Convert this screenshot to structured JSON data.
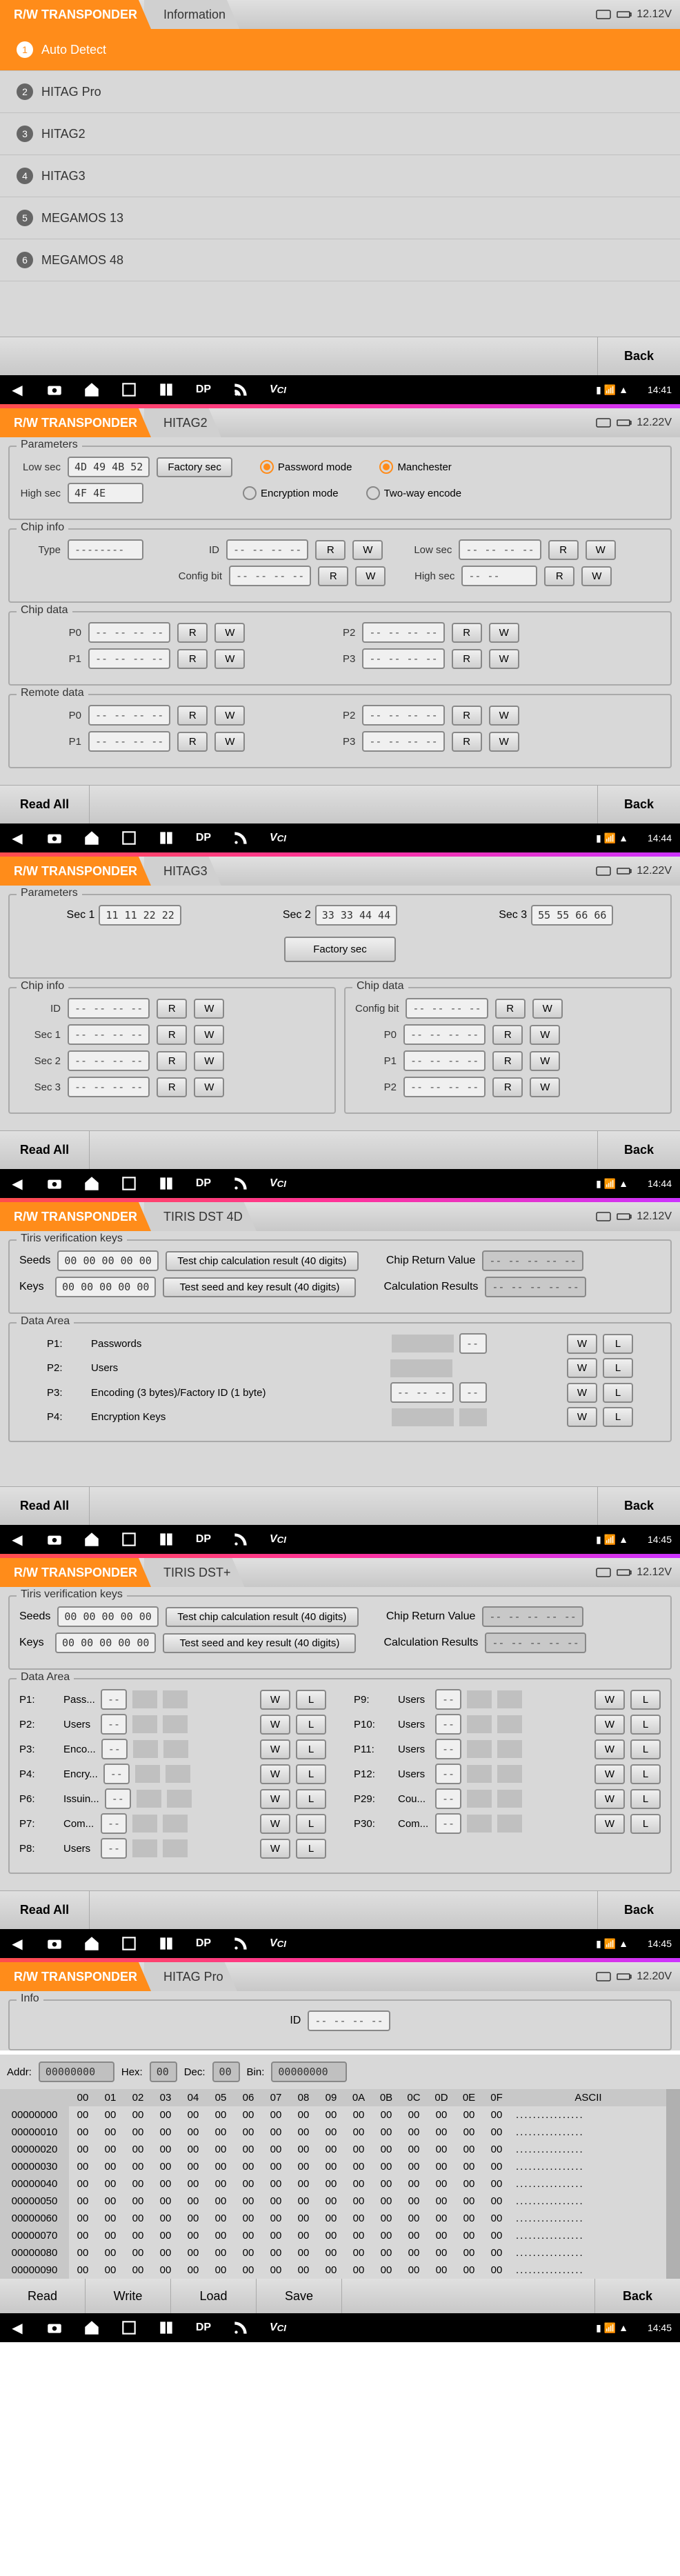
{
  "screen1": {
    "tab1": "R/W TRANSPONDER",
    "tab2": "Information",
    "voltage": "12.12V",
    "items": [
      "Auto Detect",
      "HITAG Pro",
      "HITAG2",
      "HITAG3",
      "MEGAMOS 13",
      "MEGAMOS 48"
    ],
    "back": "Back",
    "time": "14:41"
  },
  "screen2": {
    "tab1": "R/W TRANSPONDER",
    "tab2": "HITAG2",
    "voltage": "12.22V",
    "params_title": "Parameters",
    "lowsec_label": "Low sec",
    "lowsec_val": "4D 49 4B 52",
    "highsec_label": "High sec",
    "highsec_val": "4F 4E",
    "factory_sec": "Factory sec",
    "pw_mode": "Password mode",
    "enc_mode": "Encryption mode",
    "manchester": "Manchester",
    "twoway": "Two-way encode",
    "chipinfo_title": "Chip info",
    "type_label": "Type",
    "type_val": "--------",
    "id_label": "ID",
    "config_label": "Config bit",
    "lowsec2": "Low sec",
    "highsec2": "High sec",
    "chipdata_title": "Chip data",
    "remote_title": "Remote data",
    "p0": "P0",
    "p1": "P1",
    "p2": "P2",
    "p3": "P3",
    "R": "R",
    "W": "W",
    "dash4": "-- -- -- --",
    "dash2": "-- --",
    "readall": "Read All",
    "back": "Back",
    "time": "14:44"
  },
  "screen3": {
    "tab1": "R/W TRANSPONDER",
    "tab2": "HITAG3",
    "voltage": "12.22V",
    "params_title": "Parameters",
    "sec1_label": "Sec 1",
    "sec1_val": "11 11 22 22",
    "sec2_label": "Sec 2",
    "sec2_val": "33 33 44 44",
    "sec3_label": "Sec 3",
    "sec3_val": "55 55 66 66",
    "factory_sec": "Factory sec",
    "chipinfo_title": "Chip info",
    "chipdata_title": "Chip data",
    "id": "ID",
    "sec1": "Sec 1",
    "sec2": "Sec 2",
    "sec3": "Sec 3",
    "config": "Config bit",
    "p0": "P0",
    "p1": "P1",
    "p2": "P2",
    "R": "R",
    "W": "W",
    "dash4": "-- -- -- --",
    "readall": "Read All",
    "back": "Back",
    "time": "14:44"
  },
  "screen4": {
    "tab1": "R/W TRANSPONDER",
    "tab2": "TIRIS DST 4D",
    "voltage": "12.12V",
    "tiris_title": "Tiris verification keys",
    "seeds_label": "Seeds",
    "seeds_val": "00 00 00 00 00",
    "keys_label": "Keys",
    "keys_val": "00 00 00 00 00",
    "test_chip": "Test chip calculation result (40 digits)",
    "test_seed": "Test seed and key result (40 digits)",
    "chip_return": "Chip Return Value",
    "chip_return_val": "-- -- -- -- --",
    "calc_results": "Calculation Results",
    "calc_results_val": "-- -- -- -- --",
    "data_title": "Data Area",
    "p1_label": "P1:",
    "p1_name": "Passwords",
    "p2_label": "P2:",
    "p2_name": "Users",
    "p3_label": "P3:",
    "p3_name": "Encoding (3 bytes)/Factory ID (1 byte)",
    "p4_label": "P4:",
    "p4_name": "Encryption Keys",
    "dash2": "--",
    "dash3": "-- -- --",
    "dash5": "-- -- -- -- --",
    "W": "W",
    "L": "L",
    "readall": "Read All",
    "back": "Back",
    "time": "14:45"
  },
  "screen5": {
    "tab1": "R/W TRANSPONDER",
    "tab2": "TIRIS DST+",
    "voltage": "12.12V",
    "tiris_title": "Tiris verification keys",
    "seeds_label": "Seeds",
    "seeds_val": "00 00 00 00 00",
    "keys_label": "Keys",
    "keys_val": "00 00 00 00 00",
    "test_chip": "Test chip calculation result (40 digits)",
    "test_seed": "Test seed and key result (40 digits)",
    "chip_return": "Chip Return Value",
    "chip_return_val": "-- -- -- -- --",
    "calc_results": "Calculation Results",
    "calc_results_val": "-- -- -- -- --",
    "data_title": "Data Area",
    "rows": [
      {
        "l": "P1:",
        "n": "Pass..."
      },
      {
        "l": "P2:",
        "n": "Users"
      },
      {
        "l": "P3:",
        "n": "Enco..."
      },
      {
        "l": "P4:",
        "n": "Encry..."
      },
      {
        "l": "P6:",
        "n": "Issuin..."
      },
      {
        "l": "P7:",
        "n": "Com..."
      },
      {
        "l": "P8:",
        "n": "Users"
      }
    ],
    "rows2": [
      {
        "l": "P9:",
        "n": "Users"
      },
      {
        "l": "P10:",
        "n": "Users"
      },
      {
        "l": "P11:",
        "n": "Users"
      },
      {
        "l": "P12:",
        "n": "Users"
      },
      {
        "l": "P29:",
        "n": "Cou..."
      },
      {
        "l": "P30:",
        "n": "Com..."
      }
    ],
    "W": "W",
    "L": "L",
    "dash": "--",
    "readall": "Read All",
    "back": "Back",
    "time": "14:45"
  },
  "screen6": {
    "tab1": "R/W TRANSPONDER",
    "tab2": "HITAG Pro",
    "voltage": "12.20V",
    "info_title": "Info",
    "id_label": "ID",
    "id_val": "-- -- -- --",
    "addr_label": "Addr:",
    "addr_val": "00000000",
    "hex_label": "Hex:",
    "hex_val": "00",
    "dec_label": "Dec:",
    "dec_val": "00",
    "bin_label": "Bin:",
    "bin_val": "00000000",
    "cols": [
      "00",
      "01",
      "02",
      "03",
      "04",
      "05",
      "06",
      "07",
      "08",
      "09",
      "0A",
      "0B",
      "0C",
      "0D",
      "0E",
      "0F"
    ],
    "ascii_header": "ASCII",
    "rowaddrs": [
      "00000000",
      "00000010",
      "00000020",
      "00000030",
      "00000040",
      "00000050",
      "00000060",
      "00000070",
      "00000080",
      "00000090"
    ],
    "cell": "00",
    "ascii": "................",
    "read": "Read",
    "write": "Write",
    "load": "Load",
    "save": "Save",
    "back": "Back",
    "time": "14:45"
  }
}
